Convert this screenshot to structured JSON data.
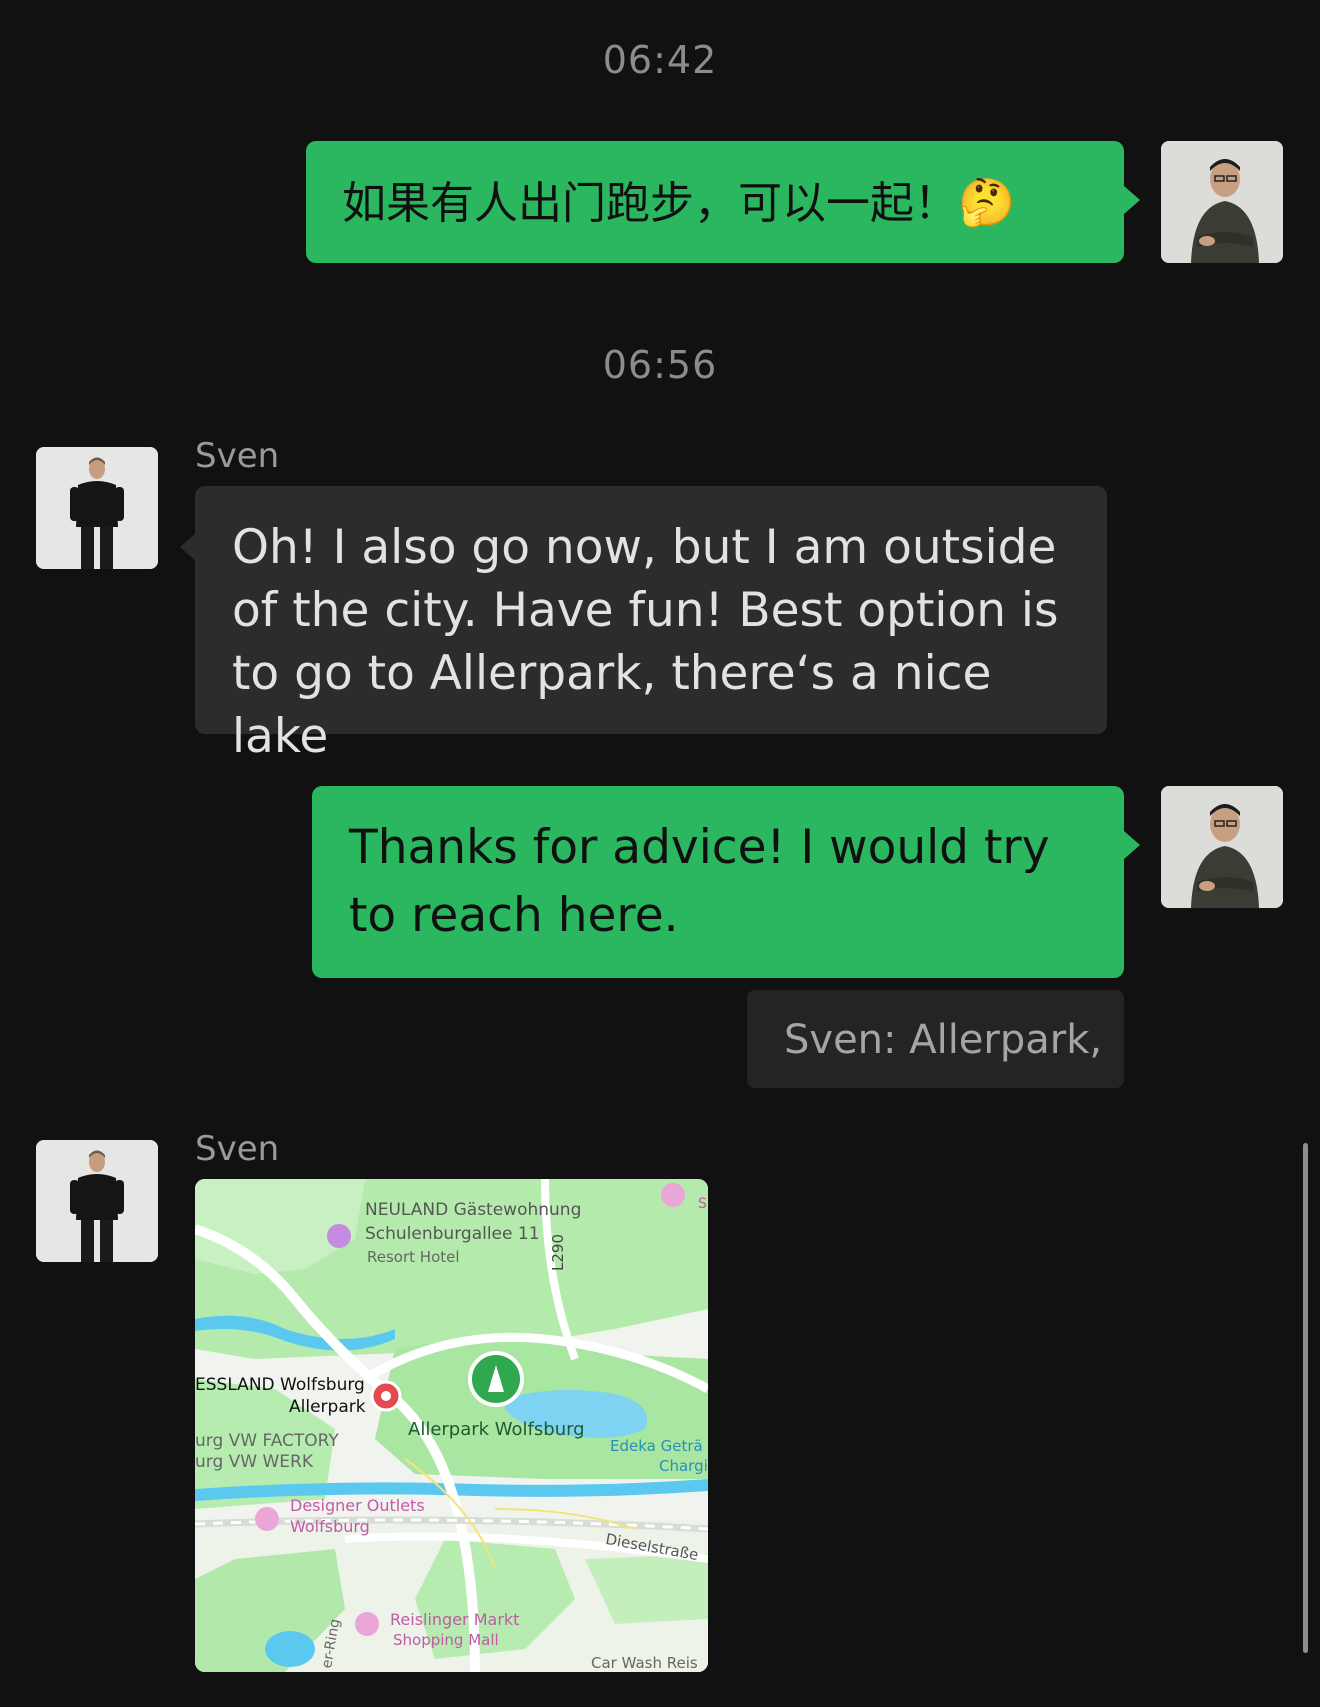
{
  "messages": {
    "time1": "06:42",
    "msg1": "如果有人出门跑步，可以一起！",
    "msg1_emoji": "🤔",
    "time2": "06:56",
    "sender": "Sven",
    "msg2": "Oh! I also go now, but I am outside of the city. Have fun! Best option is to go to Allerpark, there‘s a nice lake",
    "msg3": "Thanks for advice! I would try to reach here.",
    "quote": "Sven: Allerpark,",
    "sender2": "Sven"
  },
  "map": {
    "labels": {
      "neuland": "NEULAND Gästewohnung",
      "schulenburg": "Schulenburgallee 11",
      "resort": "Resort Hotel",
      "road_l290": "L290",
      "essland": "ESSLAND Wolfsburg",
      "allerpark_small": "Allerpark",
      "allerpark_wolfsburg": "Allerpark Wolfsburg",
      "vw_factory": "urg VW FACTORY",
      "vw_werk": "urg VW WERK",
      "edeka": "Edeka Geträ",
      "chargi": "Chargi",
      "designer": "Designer Outlets",
      "wolfsburg": "Wolfsburg",
      "dieselstrasse": "Dieselstraße",
      "ring": "er-Ring",
      "reislinger": "Reislinger Markt",
      "shopping": "Shopping Mall",
      "carwash": "Car Wash Reis",
      "edge_s": "S"
    },
    "colors": {
      "park": "#a8e6a1",
      "water": "#5bc8f0",
      "road": "#ffffff",
      "pin_red": "#e5484d",
      "pin_green": "#2fa84f",
      "poi_purple": "#c58be0"
    }
  }
}
